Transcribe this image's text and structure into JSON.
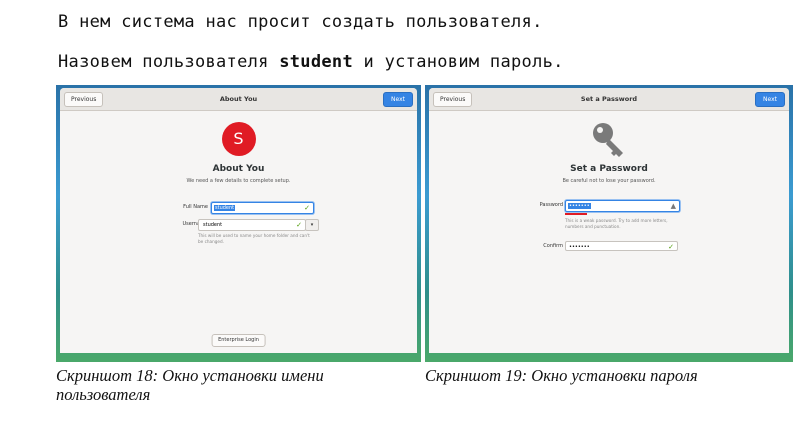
{
  "document": {
    "line1": "В нем система нас просит создать пользователя.",
    "line2_before": "Назовем пользователя ",
    "line2_bold": "student",
    "line2_after": " и установим пароль."
  },
  "shot18": {
    "previous": "Previous",
    "next": "Next",
    "window_title": "About You",
    "avatar_letter": "S",
    "heading": "About You",
    "subheading": "We need a few details to complete setup.",
    "fullname_label": "Full Name",
    "fullname_value": "student",
    "username_label": "Username",
    "username_value": "student",
    "username_hint": "This will be used to name your home folder and can't be changed.",
    "enterprise_button": "Enterprise Login",
    "caption": "Скриншот 18: Окно установки имени пользователя"
  },
  "shot19": {
    "previous": "Previous",
    "next": "Next",
    "window_title": "Set a Password",
    "heading": "Set a Password",
    "subheading": "Be careful not to lose your password.",
    "password_label": "Password",
    "password_value": "•••••••",
    "password_hint": "This is a weak password. Try to add more letters, numbers and punctuation.",
    "confirm_label": "Confirm",
    "confirm_value": "•••••••",
    "caption": "Скриншот 19: Окно установки пароля"
  },
  "colors": {
    "accent": "#3584e4",
    "avatar": "#e01b24",
    "weak_strength": "#e01b24"
  }
}
